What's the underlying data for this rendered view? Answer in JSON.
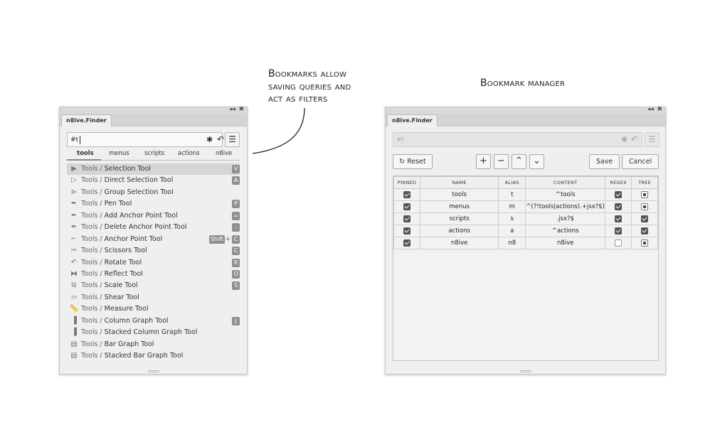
{
  "annotations": {
    "left_note": [
      "Bookmarks allow",
      "saving queries and",
      "act as filters"
    ],
    "right_note": "Bookmark manager"
  },
  "finder": {
    "tab_title": "n8ive.Finder",
    "window_controls": {
      "collapse": "◂◂",
      "close": "✖"
    },
    "search": {
      "value": "#t",
      "star_icon": "✱",
      "back_icon": "↶"
    },
    "menu_icon": "☰",
    "filters": [
      "tools",
      "menus",
      "scripts",
      "actions",
      "n8ive"
    ],
    "active_filter": "tools",
    "results": [
      {
        "category": "Tools / ",
        "name": "Selection Tool",
        "icon": "selection-tool-icon",
        "glyph": "▶",
        "keys": [
          "V"
        ],
        "selected": true
      },
      {
        "category": "Tools / ",
        "name": "Direct Selection Tool",
        "icon": "direct-selection-tool-icon",
        "glyph": "▷",
        "keys": [
          "A"
        ]
      },
      {
        "category": "Tools / ",
        "name": "Group Selection Tool",
        "icon": "group-selection-tool-icon",
        "glyph": "⊳",
        "keys": []
      },
      {
        "category": "Tools / ",
        "name": "Pen Tool",
        "icon": "pen-tool-icon",
        "glyph": "✒",
        "keys": [
          "P"
        ]
      },
      {
        "category": "Tools / ",
        "name": "Add Anchor Point Tool",
        "icon": "add-anchor-point-tool-icon",
        "glyph": "✒",
        "keys": [
          "="
        ]
      },
      {
        "category": "Tools / ",
        "name": "Delete Anchor Point Tool",
        "icon": "delete-anchor-point-tool-icon",
        "glyph": "✒",
        "keys": [
          "-"
        ]
      },
      {
        "category": "Tools / ",
        "name": "Anchor Point Tool",
        "icon": "anchor-point-tool-icon",
        "glyph": "⌐",
        "keys": [
          "Shift",
          "C"
        ]
      },
      {
        "category": "Tools / ",
        "name": "Scissors Tool",
        "icon": "scissors-tool-icon",
        "glyph": "✂",
        "keys": [
          "C"
        ]
      },
      {
        "category": "Tools / ",
        "name": "Rotate Tool",
        "icon": "rotate-tool-icon",
        "glyph": "↶",
        "keys": [
          "R"
        ]
      },
      {
        "category": "Tools / ",
        "name": "Reflect Tool",
        "icon": "reflect-tool-icon",
        "glyph": "⧓",
        "keys": [
          "O"
        ]
      },
      {
        "category": "Tools / ",
        "name": "Scale Tool",
        "icon": "scale-tool-icon",
        "glyph": "⧉",
        "keys": [
          "S"
        ]
      },
      {
        "category": "Tools / ",
        "name": "Shear Tool",
        "icon": "shear-tool-icon",
        "glyph": "▱",
        "keys": []
      },
      {
        "category": "Tools / ",
        "name": "Measure Tool",
        "icon": "measure-tool-icon",
        "glyph": "📏",
        "keys": []
      },
      {
        "category": "Tools / ",
        "name": "Column Graph Tool",
        "icon": "column-graph-tool-icon",
        "glyph": "▐",
        "keys": [
          "J"
        ]
      },
      {
        "category": "Tools / ",
        "name": "Stacked Column Graph Tool",
        "icon": "stacked-column-graph-tool-icon",
        "glyph": "▐",
        "keys": []
      },
      {
        "category": "Tools / ",
        "name": "Bar Graph Tool",
        "icon": "bar-graph-tool-icon",
        "glyph": "▤",
        "keys": []
      },
      {
        "category": "Tools / ",
        "name": "Stacked Bar Graph Tool",
        "icon": "stacked-bar-graph-tool-icon",
        "glyph": "▤",
        "keys": []
      }
    ],
    "key_separator": "+"
  },
  "manager": {
    "tab_title": "n8ive.Finder",
    "window_controls": {
      "collapse": "◂◂",
      "close": "✖"
    },
    "search": {
      "value": "#t",
      "star_icon": "✱",
      "back_icon": "↶"
    },
    "menu_icon": "☰",
    "buttons": {
      "reset": "Reset",
      "reset_icon": "↻",
      "add": "+",
      "remove": "−",
      "move_up": "⌃",
      "move_down": "⌄",
      "save": "Save",
      "cancel": "Cancel"
    },
    "columns": [
      "Pinned",
      "Name",
      "Alias",
      "Content",
      "Regex",
      "Tree"
    ],
    "rows": [
      {
        "pinned": "on",
        "name": "tools",
        "alias": "t",
        "content": "^tools",
        "regex": "on",
        "tree": "mixed"
      },
      {
        "pinned": "on",
        "name": "menus",
        "alias": "m",
        "content": "^(?!tools|actions).+jsx?$)",
        "regex": "on",
        "tree": "mixed"
      },
      {
        "pinned": "on",
        "name": "scripts",
        "alias": "s",
        "content": ".jsx?$",
        "regex": "on",
        "tree": "on"
      },
      {
        "pinned": "on",
        "name": "actions",
        "alias": "a",
        "content": "^actions",
        "regex": "on",
        "tree": "on"
      },
      {
        "pinned": "on",
        "name": "n8ive",
        "alias": "n8",
        "content": "n8ive",
        "regex": "off",
        "tree": "mixed"
      }
    ]
  }
}
